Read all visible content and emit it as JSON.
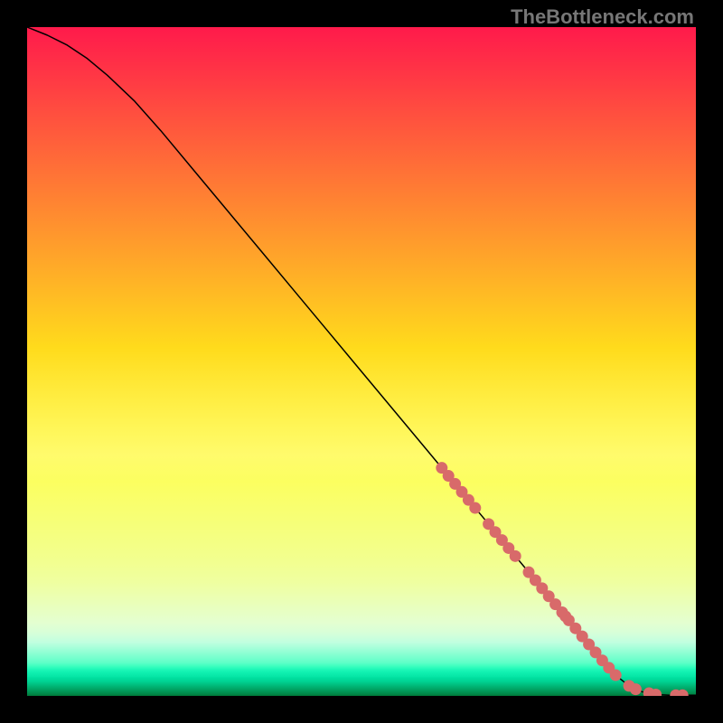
{
  "watermark": "TheBottleneck.com",
  "chart_data": {
    "type": "line",
    "title": "",
    "xlabel": "",
    "ylabel": "",
    "xlim": [
      0,
      100
    ],
    "ylim": [
      0,
      100
    ],
    "grid": false,
    "series": [
      {
        "name": "curve",
        "x": [
          0,
          3,
          6,
          9,
          12,
          16,
          20,
          25,
          30,
          35,
          40,
          45,
          50,
          55,
          60,
          65,
          70,
          75,
          78,
          80,
          82,
          84,
          86,
          88,
          90,
          92,
          94,
          96,
          98,
          100
        ],
        "y": [
          100,
          98.8,
          97.3,
          95.3,
          92.8,
          89.0,
          84.5,
          78.5,
          72.5,
          66.5,
          60.5,
          54.5,
          48.5,
          42.5,
          36.5,
          30.5,
          24.5,
          18.5,
          14.9,
          12.5,
          10.1,
          7.7,
          5.3,
          3.1,
          1.5,
          0.6,
          0.2,
          0.1,
          0.1,
          0.1
        ]
      }
    ],
    "highlight_points": {
      "x": [
        62,
        63,
        64,
        65,
        66,
        67,
        69,
        70,
        71,
        72,
        73,
        75,
        76,
        77,
        78,
        79,
        80,
        80.5,
        81,
        82,
        83,
        84,
        85,
        86,
        87,
        88,
        90,
        91,
        93,
        94,
        97,
        98
      ],
      "y": [
        34.1,
        32.9,
        31.7,
        30.5,
        29.3,
        28.1,
        25.7,
        24.5,
        23.3,
        22.1,
        20.9,
        18.5,
        17.3,
        16.1,
        14.9,
        13.7,
        12.5,
        11.9,
        11.3,
        10.1,
        8.9,
        7.7,
        6.5,
        5.3,
        4.2,
        3.1,
        1.5,
        1.0,
        0.4,
        0.2,
        0.1,
        0.1
      ]
    },
    "dot_color": "#d86a6a",
    "line_color": "#000000"
  }
}
